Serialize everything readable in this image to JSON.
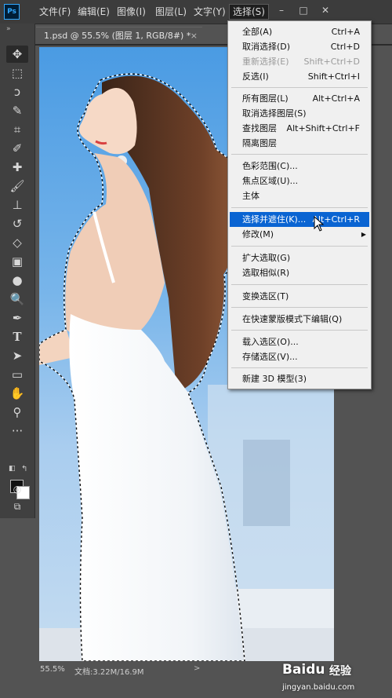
{
  "app": {
    "logo": "Ps"
  },
  "menubar": {
    "items": [
      "文件(F)",
      "编辑(E)",
      "图像(I)",
      "图层(L)",
      "文字(Y)",
      "选择(S)"
    ],
    "active_index": 5,
    "window_controls": [
      "–",
      "□",
      "✕"
    ]
  },
  "document": {
    "tab_title": "1.psd @ 55.5% (图层 1, RGB/8#) *",
    "tab_close": "×",
    "zoom": "55.5%",
    "doc_info": "文档:3.22M/16.9M",
    "status_arrow": ">"
  },
  "tools": [
    "move-icon",
    "marquee-icon",
    "lasso-icon",
    "quick-select-icon",
    "crop-icon",
    "eyedropper-icon",
    "healing-icon",
    "brush-icon",
    "stamp-icon",
    "history-brush-icon",
    "eraser-icon",
    "gradient-icon",
    "blur-icon",
    "dodge-icon",
    "pen-icon",
    "type-icon",
    "path-select-icon",
    "shape-icon",
    "hand-icon",
    "zoom-icon",
    "more-icon"
  ],
  "select_menu": {
    "items": [
      {
        "label": "全部(A)",
        "shortcut": "Ctrl+A",
        "disabled": false
      },
      {
        "label": "取消选择(D)",
        "shortcut": "Ctrl+D",
        "disabled": false
      },
      {
        "label": "重新选择(E)",
        "shortcut": "Shift+Ctrl+D",
        "disabled": true
      },
      {
        "label": "反选(I)",
        "shortcut": "Shift+Ctrl+I",
        "disabled": false
      },
      {
        "label": "所有图层(L)",
        "shortcut": "Alt+Ctrl+A",
        "disabled": false
      },
      {
        "label": "取消选择图层(S)",
        "shortcut": "",
        "disabled": false
      },
      {
        "label": "查找图层",
        "shortcut": "Alt+Shift+Ctrl+F",
        "disabled": false
      },
      {
        "label": "隔离图层",
        "shortcut": "",
        "disabled": false
      },
      {
        "label": "色彩范围(C)...",
        "shortcut": "",
        "disabled": false
      },
      {
        "label": "焦点区域(U)...",
        "shortcut": "",
        "disabled": false
      },
      {
        "label": "主体",
        "shortcut": "",
        "disabled": false
      },
      {
        "label": "选择并遮住(K)...",
        "shortcut": "Alt+Ctrl+R",
        "disabled": false,
        "highlighted": true
      },
      {
        "label": "修改(M)",
        "shortcut": "",
        "disabled": false,
        "submenu": true
      },
      {
        "label": "扩大选取(G)",
        "shortcut": "",
        "disabled": false
      },
      {
        "label": "选取相似(R)",
        "shortcut": "",
        "disabled": false
      },
      {
        "label": "变换选区(T)",
        "shortcut": "",
        "disabled": false
      },
      {
        "label": "在快速蒙版模式下编辑(Q)",
        "shortcut": "",
        "disabled": false
      },
      {
        "label": "载入选区(O)...",
        "shortcut": "",
        "disabled": false
      },
      {
        "label": "存储选区(V)...",
        "shortcut": "",
        "disabled": false
      },
      {
        "label": "新建 3D 模型(3)",
        "shortcut": "",
        "disabled": false
      }
    ]
  },
  "watermark": {
    "brand": "Baidu",
    "brand_cn": "经验",
    "url": "jingyan.baidu.com"
  },
  "colors": {
    "highlight": "#0a64d2",
    "menu_bg": "#f0f0f0",
    "app_bg": "#535353"
  }
}
